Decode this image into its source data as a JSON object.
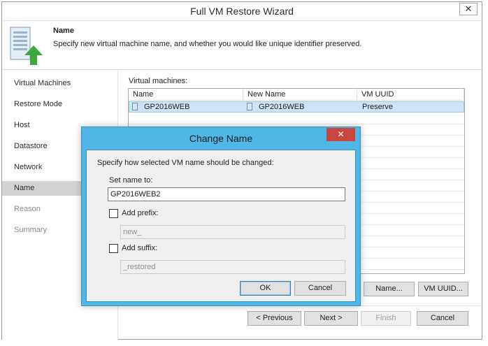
{
  "window": {
    "title": "Full VM Restore Wizard",
    "close_glyph": "✕"
  },
  "header": {
    "title": "Name",
    "description": "Specify new virtual machine name, and whether you would like unique identifier preserved."
  },
  "nav": {
    "items": [
      {
        "label": "Virtual Machines",
        "state": "normal"
      },
      {
        "label": "Restore Mode",
        "state": "normal"
      },
      {
        "label": "Host",
        "state": "normal"
      },
      {
        "label": "Datastore",
        "state": "normal"
      },
      {
        "label": "Network",
        "state": "normal"
      },
      {
        "label": "Name",
        "state": "active"
      },
      {
        "label": "Reason",
        "state": "disabled"
      },
      {
        "label": "Summary",
        "state": "disabled"
      }
    ]
  },
  "vm_table": {
    "label": "Virtual machines:",
    "columns": [
      "Name",
      "New Name",
      "VM UUID"
    ],
    "rows": [
      {
        "name": "GP2016WEB",
        "new_name": "GP2016WEB",
        "uuid": "Preserve",
        "selected": true
      }
    ]
  },
  "table_buttons": {
    "name": "Name...",
    "vm_uuid": "VM UUID..."
  },
  "footer": {
    "previous": "< Previous",
    "next": "Next >",
    "finish": "Finish",
    "cancel": "Cancel"
  },
  "dialog": {
    "title": "Change Name",
    "close_glyph": "✕",
    "instruction": "Specify how selected VM name should be changed:",
    "set_name_label": "Set name to:",
    "set_name_value": "GP2016WEB2",
    "prefix_label": "Add prefix:",
    "prefix_checked": false,
    "prefix_placeholder": "new_",
    "suffix_label": "Add suffix:",
    "suffix_checked": false,
    "suffix_placeholder": "_restored",
    "ok": "OK",
    "cancel": "Cancel"
  },
  "colors": {
    "dialog_frame": "#4fb6e6",
    "close_button": "#c9453f",
    "selection": "#cce4f7",
    "icon_green": "#3aa93a"
  }
}
